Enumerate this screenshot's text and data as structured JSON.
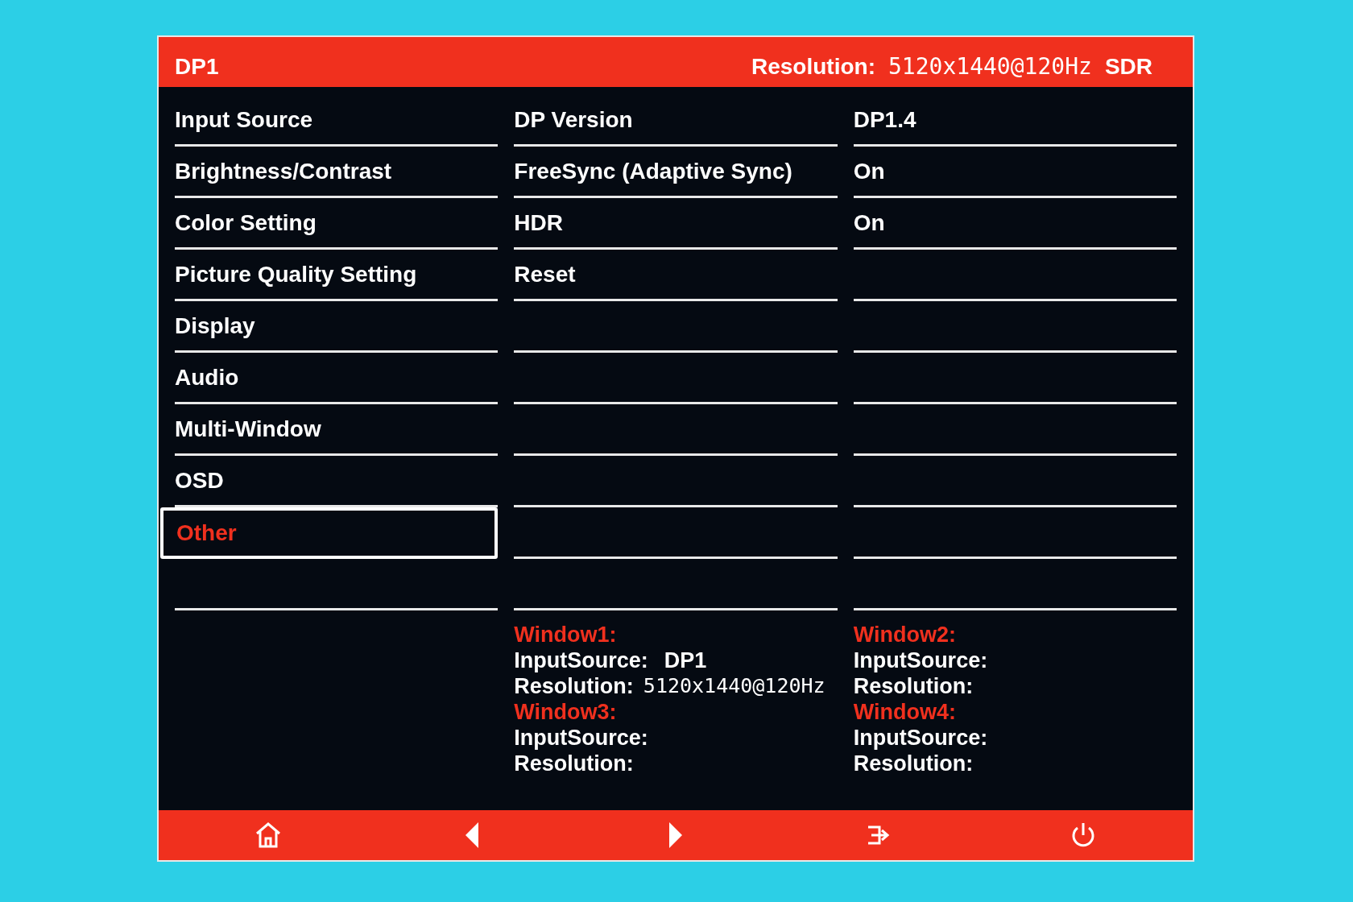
{
  "header": {
    "input": "DP1",
    "resolution_label": "Resolution:",
    "resolution": "5120x1440@120Hz",
    "dynamic_range": "SDR"
  },
  "menu": [
    {
      "label": "Input Source",
      "selected": false
    },
    {
      "label": "Brightness/Contrast",
      "selected": false
    },
    {
      "label": "Color Setting",
      "selected": false
    },
    {
      "label": "Picture Quality Setting",
      "selected": false
    },
    {
      "label": "Display",
      "selected": false
    },
    {
      "label": "Audio",
      "selected": false
    },
    {
      "label": "Multi-Window",
      "selected": false
    },
    {
      "label": "OSD",
      "selected": false
    },
    {
      "label": "Other",
      "selected": true
    }
  ],
  "settings": [
    {
      "label": "DP Version",
      "value": "DP1.4"
    },
    {
      "label": "FreeSync (Adaptive Sync)",
      "value": "On"
    },
    {
      "label": "HDR",
      "value": "On"
    },
    {
      "label": "Reset"
    }
  ],
  "windows": [
    {
      "title": "Window1:",
      "input_label": "InputSource:",
      "input": "DP1",
      "resolution_label": "Resolution:",
      "resolution": "5120x1440@120Hz"
    },
    {
      "title": "Window2:",
      "input_label": "InputSource:",
      "resolution_label": "Resolution:"
    },
    {
      "title": "Window3:",
      "input_label": "InputSource:",
      "resolution_label": "Resolution:"
    },
    {
      "title": "Window4:",
      "input_label": "InputSource:",
      "resolution_label": "Resolution:"
    }
  ],
  "footer": [
    {
      "kind": "home"
    },
    {
      "kind": "left"
    },
    {
      "kind": "right"
    },
    {
      "kind": "exit"
    },
    {
      "kind": "power"
    }
  ]
}
